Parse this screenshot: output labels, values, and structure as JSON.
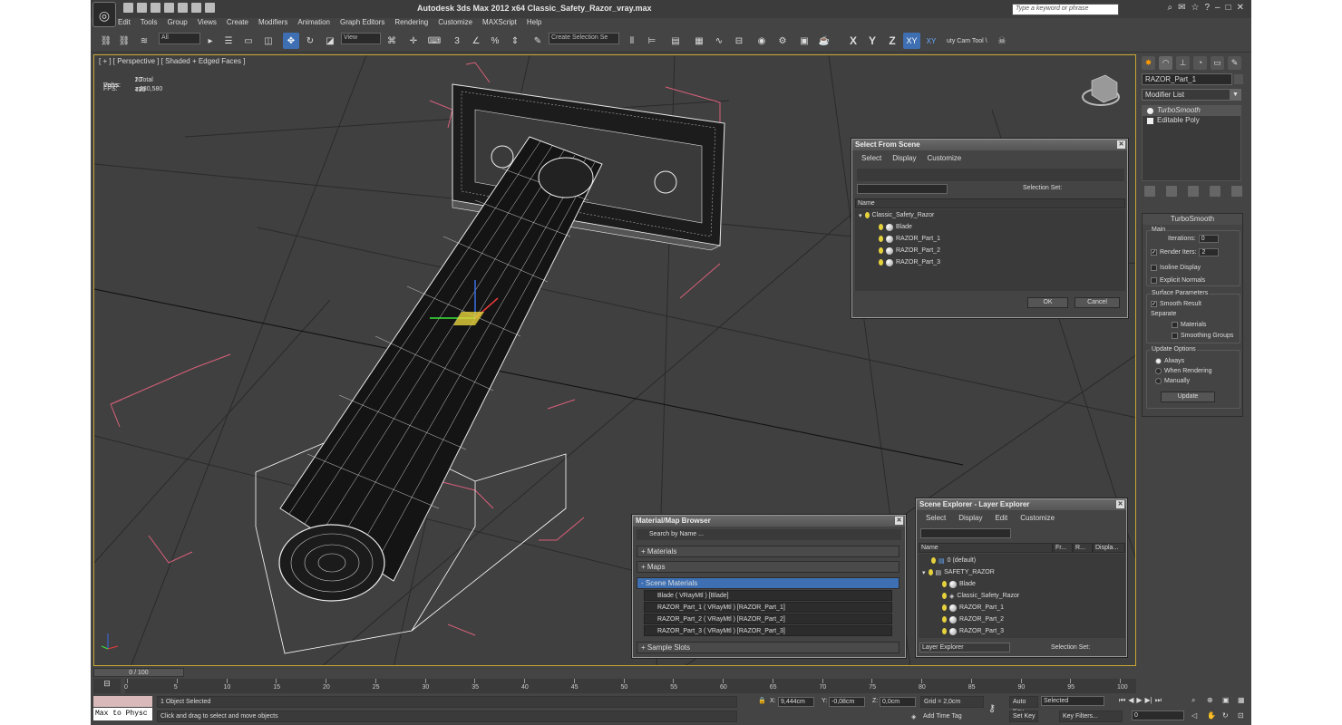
{
  "app": {
    "title": "Autodesk 3ds Max  2012 x64     Classic_Safety_Razor_vray.max",
    "search_placeholder": "Type a keyword or phrase"
  },
  "menu": [
    "Edit",
    "Tools",
    "Group",
    "Views",
    "Create",
    "Modifiers",
    "Animation",
    "Graph Editors",
    "Rendering",
    "Customize",
    "MAXScript",
    "Help"
  ],
  "toolbar": {
    "filter": "All",
    "ref_coord": "View",
    "named_selection": "Create Selection Se",
    "axis_x": "X",
    "axis_y": "Y",
    "axis_z": "Z",
    "axis_xy": "XY",
    "axis_xy2": "XY",
    "cam_tool": "uty Cam Tool \\"
  },
  "viewport": {
    "label": "[ + ] [ Perspective ] [ Shaded + Edged Faces ]",
    "stats": {
      "total_label": "Total",
      "polys_label": "Polys:",
      "polys": "20 776",
      "verts_label": "Verts:",
      "verts": "10 400",
      "fps_label": "FPS:",
      "fps": "230,580"
    }
  },
  "command_panel": {
    "object_name": "RAZOR_Part_1",
    "modifier_list": "Modifier List",
    "stack": [
      "TurboSmooth",
      "Editable Poly"
    ],
    "turbosmooth": {
      "title": "TurboSmooth",
      "main": "Main",
      "iterations_label": "Iterations:",
      "iterations": "0",
      "render_iters_label": "Render Iters:",
      "render_iters": "2",
      "isoline": "Isoline Display",
      "explicit_normals": "Explicit Normals",
      "surface_params": "Surface Parameters",
      "smooth_result": "Smooth Result",
      "separate": "Separate",
      "materials": "Materials",
      "smoothing_groups": "Smoothing Groups",
      "update_options": "Update Options",
      "always": "Always",
      "when_rendering": "When Rendering",
      "manually": "Manually",
      "update_button": "Update"
    }
  },
  "select_from_scene": {
    "title": "Select From Scene",
    "menu": [
      "Select",
      "Display",
      "Customize"
    ],
    "selection_set_label": "Selection Set:",
    "col_name": "Name",
    "root": "Classic_Safety_Razor",
    "items": [
      "Blade",
      "RAZOR_Part_1",
      "RAZOR_Part_2",
      "RAZOR_Part_3"
    ],
    "ok": "OK",
    "cancel": "Cancel"
  },
  "material_browser": {
    "title": "Material/Map Browser",
    "search": "Search by Name ...",
    "materials": "+ Materials",
    "maps": "+ Maps",
    "scene_materials": "- Scene Materials",
    "items": [
      "Blade  ( VRayMtl )  [Blade]",
      "RAZOR_Part_1  ( VRayMtl )  [RAZOR_Part_1]",
      "RAZOR_Part_2  ( VRayMtl )  [RAZOR_Part_2]",
      "RAZOR_Part_3  ( VRayMtl )  [RAZOR_Part_3]"
    ],
    "sample_slots": "+ Sample Slots"
  },
  "scene_explorer": {
    "title": "Scene Explorer - Layer Explorer",
    "menu": [
      "Select",
      "Display",
      "Edit",
      "Customize"
    ],
    "cols": [
      "Name",
      "Fr...",
      "R...",
      "Displa..."
    ],
    "rows": [
      "0 (default)",
      "SAFETY_RAZOR",
      "Blade",
      "Classic_Safety_Razor",
      "RAZOR_Part_1",
      "RAZOR_Part_2",
      "RAZOR_Part_3"
    ],
    "footer_dropdown": "Layer Explorer",
    "selection_set": "Selection Set:"
  },
  "timeline": {
    "slider": "0 / 100",
    "ticks": [
      "0",
      "5",
      "10",
      "15",
      "20",
      "25",
      "30",
      "35",
      "40",
      "45",
      "50",
      "55",
      "60",
      "65",
      "70",
      "75",
      "80",
      "85",
      "90",
      "95",
      "100"
    ]
  },
  "status": {
    "maxscript": "Max to Physc",
    "selected_count": "1 Object Selected",
    "prompt": "Click and drag to select and move objects",
    "x_label": "X:",
    "x": "9,444cm",
    "y_label": "Y:",
    "y": "-0,08cm",
    "z_label": "Z:",
    "z": "0,0cm",
    "grid": "Grid = 2,0cm",
    "add_time_tag": "Add Time Tag",
    "auto_key": "Auto Key",
    "selected": "Selected",
    "set_key": "Set Key",
    "key_filters": "Key Filters...",
    "frame": "0"
  }
}
